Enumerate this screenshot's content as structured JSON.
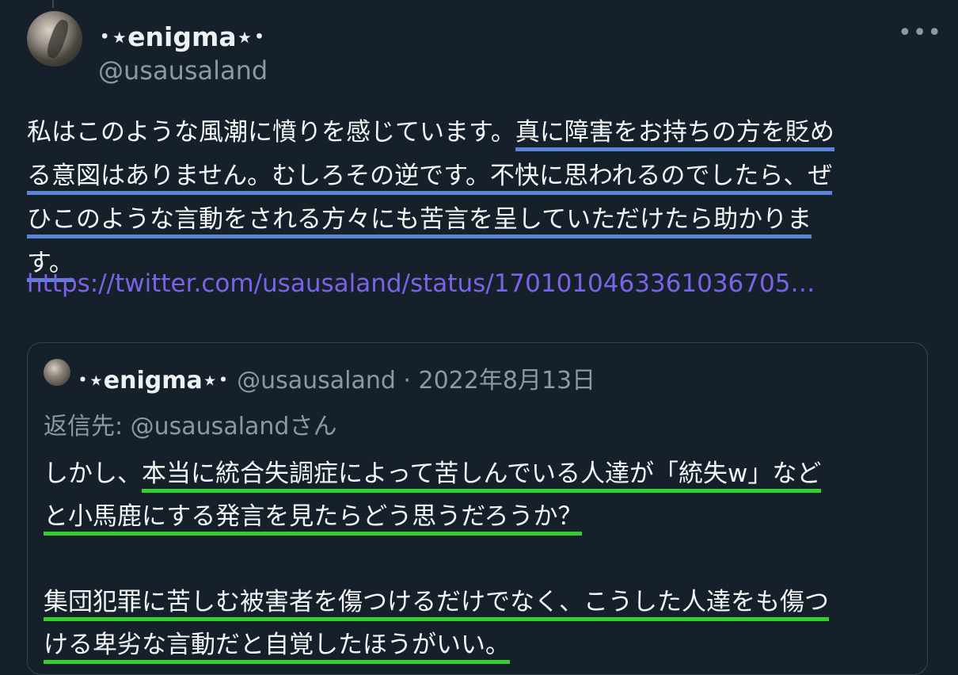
{
  "tweet": {
    "display_name": "･⋆enigma⋆･",
    "handle": "@usausaland",
    "more_label": "•••",
    "lines": [
      {
        "plain": "私はこのような風潮に憤りを感じています。",
        "hl": "真に障害をお持ちの方を貶め"
      },
      {
        "plain": "",
        "hl": "る意図はありません。むしろその逆です。不快に思われるのでしたら、ぜ"
      },
      {
        "plain": "",
        "hl": "ひこのような言動をされる方々にも苦言を呈していただけたら助かりま"
      },
      {
        "plain": "",
        "hl": "す。"
      }
    ],
    "link": "https://twitter.com/usausaland/status/17010104633610367​05…"
  },
  "quote": {
    "display_name": "･⋆enigma⋆･",
    "meta": " @usausaland · 2022年8月13日",
    "reply_to": "返信先: @usausalandさん",
    "lines": [
      {
        "plain": "しかし、",
        "hl": "本当に統合失調症によって苦しんでいる人達が「統失w」など"
      },
      {
        "plain": "",
        "hl": "と小馬鹿にする発言を見たらどう思うだろうか？"
      },
      {
        "plain": "",
        "hl": ""
      },
      {
        "plain": "",
        "hl": "集団犯罪に苦しむ被害者を傷つけるだけでなく、こうした人達をも傷つ"
      },
      {
        "plain": "",
        "hl": "ける卑劣な言動だと自覚したほうがいい。"
      }
    ]
  },
  "colors": {
    "background": "#16202b",
    "link": "#7b63e6",
    "highlight_tweet": "#5a86d8",
    "highlight_quote": "#2fd12c"
  }
}
